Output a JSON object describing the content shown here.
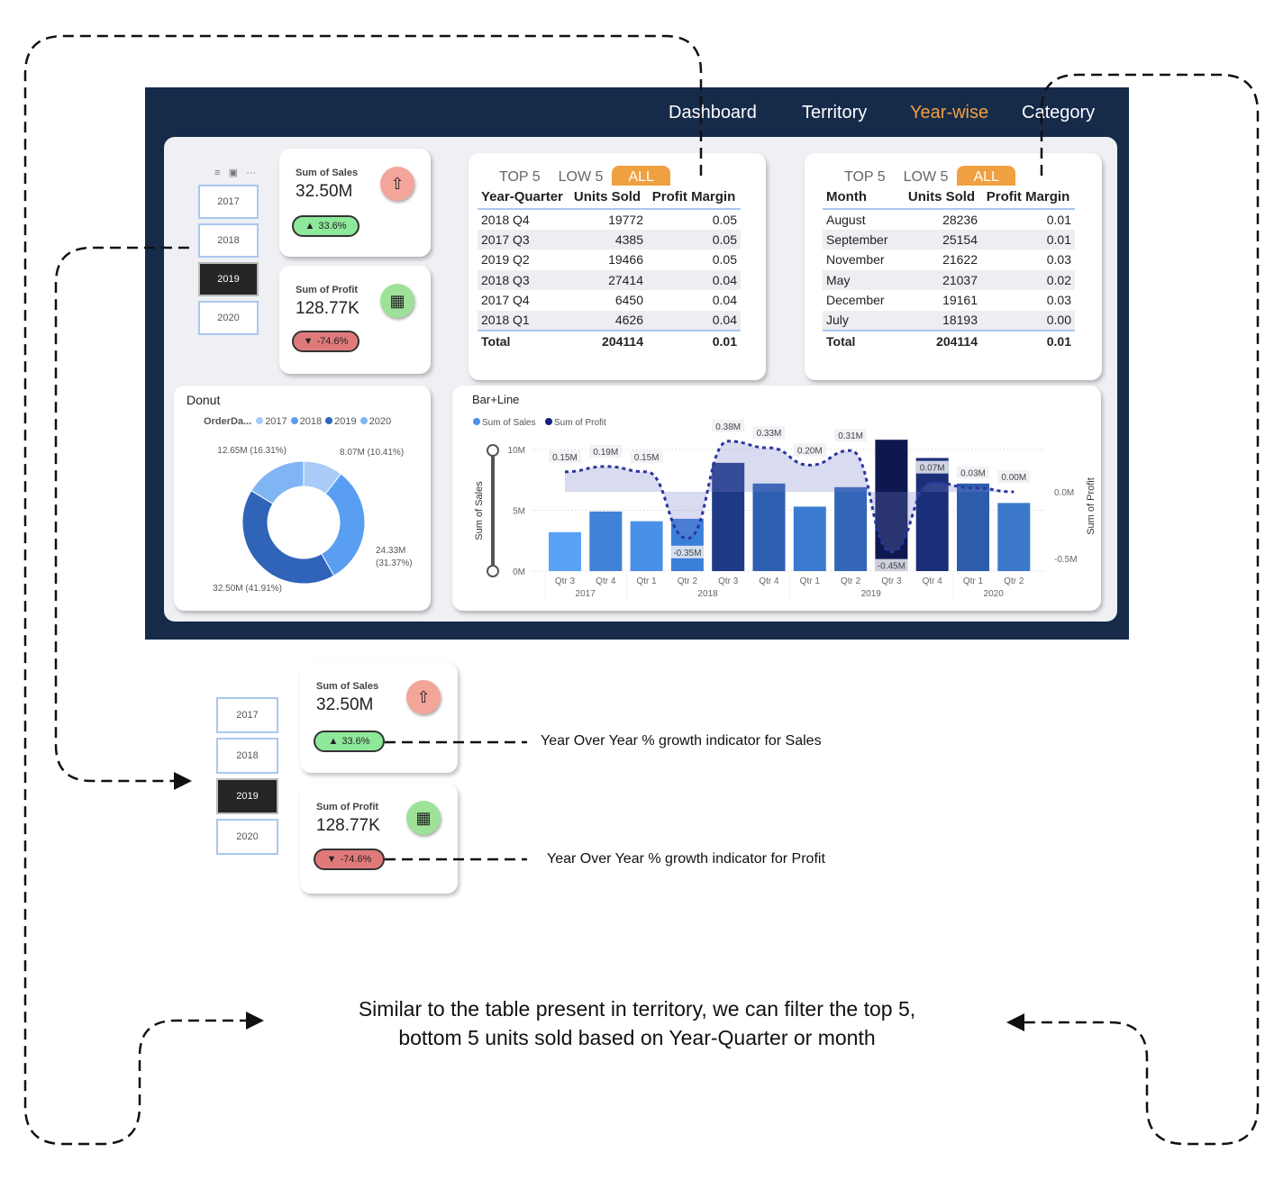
{
  "nav": {
    "items": [
      "Dashboard",
      "Territory",
      "Year-wise",
      "Category"
    ],
    "active": "Year-wise",
    "active_color": "#f0a040"
  },
  "slicer": {
    "years": [
      "2017",
      "2018",
      "2019",
      "2020"
    ],
    "selected": "2019",
    "toolbar_icons": [
      "filter-icon",
      "focus-mode-icon",
      "more-options-icon"
    ]
  },
  "kpis": {
    "sales": {
      "title": "Sum of Sales",
      "value": "32.50M",
      "growth": "33.6%",
      "direction": "up",
      "icon": "sales-growth-icon"
    },
    "profit": {
      "title": "Sum of Profit",
      "value": "128.77K",
      "growth": "-74.6%",
      "direction": "down",
      "icon": "profit-money-icon"
    }
  },
  "table_quarter": {
    "tabs": [
      "TOP 5",
      "LOW 5",
      "ALL"
    ],
    "active_tab": "ALL",
    "columns": [
      "Year-Quarter",
      "Units Sold",
      "Profit Margin"
    ],
    "rows": [
      [
        "2018 Q4",
        "19772",
        "0.05"
      ],
      [
        "2017 Q3",
        "4385",
        "0.05"
      ],
      [
        "2019 Q2",
        "19466",
        "0.05"
      ],
      [
        "2018 Q3",
        "27414",
        "0.04"
      ],
      [
        "2017 Q4",
        "6450",
        "0.04"
      ],
      [
        "2018 Q1",
        "4626",
        "0.04"
      ]
    ],
    "total": [
      "Total",
      "204114",
      "0.01"
    ]
  },
  "table_month": {
    "tabs": [
      "TOP 5",
      "LOW 5",
      "ALL"
    ],
    "active_tab": "ALL",
    "columns": [
      "Month",
      "Units Sold",
      "Profit Margin"
    ],
    "rows": [
      [
        "August",
        "28236",
        "0.01"
      ],
      [
        "September",
        "25154",
        "0.01"
      ],
      [
        "November",
        "21622",
        "0.03"
      ],
      [
        "May",
        "21037",
        "0.02"
      ],
      [
        "December",
        "19161",
        "0.03"
      ],
      [
        "July",
        "18193",
        "0.00"
      ]
    ],
    "total": [
      "Total",
      "204114",
      "0.01"
    ]
  },
  "chart_data": [
    {
      "type": "pie",
      "title": "Donut",
      "legend_title": "OrderDa...",
      "legend_placement": "top",
      "categories": [
        "2017",
        "2018",
        "2019",
        "2020"
      ],
      "values": [
        8.07,
        24.33,
        32.5,
        12.65
      ],
      "labels": [
        "8.07M (10.41%)",
        "24.33M (31.37%)",
        "32.50M (41.91%)",
        "12.65M (16.31%)"
      ],
      "colors": [
        "#a8cbf7",
        "#5a9ef2",
        "#2f64b8",
        "#7fb5f3"
      ]
    },
    {
      "type": "bar",
      "title": "Bar+Line",
      "legend_placement": "top-left",
      "series_names": [
        "Sum of Sales",
        "Sum of Profit"
      ],
      "legend_colors": [
        "#4a90e8",
        "#14207a"
      ],
      "ylabel": "Sum of Sales",
      "y2label": "Sum of Profit",
      "yticks": [
        "10M",
        "5M",
        "0M"
      ],
      "ylim": [
        0,
        10
      ],
      "y2ticks": [
        "0.0M",
        "-0.5M"
      ],
      "categories": [
        "Qtr 3",
        "Qtr 4",
        "Qtr 1",
        "Qtr 2",
        "Qtr 3",
        "Qtr 4",
        "Qtr 1",
        "Qtr 2",
        "Qtr 3",
        "Qtr 4",
        "Qtr 1",
        "Qtr 2"
      ],
      "years": [
        {
          "label": "2017",
          "span": 2
        },
        {
          "label": "2018",
          "span": 4
        },
        {
          "label": "2019",
          "span": 4
        },
        {
          "label": "2020",
          "span": 2
        }
      ],
      "sales": [
        3.2,
        4.9,
        4.1,
        4.3,
        8.9,
        7.2,
        5.3,
        6.9,
        10.8,
        9.3,
        7.2,
        5.6
      ],
      "profit": [
        0.15,
        0.19,
        0.15,
        -0.35,
        0.38,
        0.33,
        0.2,
        0.31,
        -0.45,
        0.07,
        0.03,
        0.0
      ],
      "profit_labels": [
        "0.15M",
        "0.19M",
        "0.15M",
        "-0.35M",
        "0.38M",
        "0.33M",
        "0.20M",
        "0.31M",
        "-0.45M",
        "0.07M",
        "0.03M",
        "0.00M"
      ],
      "bar_colors": [
        "#5aa2f6",
        "#3f82d8",
        "#4a90e8",
        "#3a7fd8",
        "#1e3a86",
        "#2d5fb0",
        "#3a7ad0",
        "#3366b8",
        "#0d1850",
        "#1a2f78",
        "#2d5cad",
        "#3c78cc"
      ]
    }
  ],
  "annotations": {
    "sales_note": "Year Over Year % growth indicator for Sales",
    "profit_note": "Year Over Year % growth indicator for Profit",
    "filter_note_line1": "Similar to the table present in territory, we can filter the top 5,",
    "filter_note_line2": "bottom 5  units sold based on Year-Quarter or month"
  }
}
